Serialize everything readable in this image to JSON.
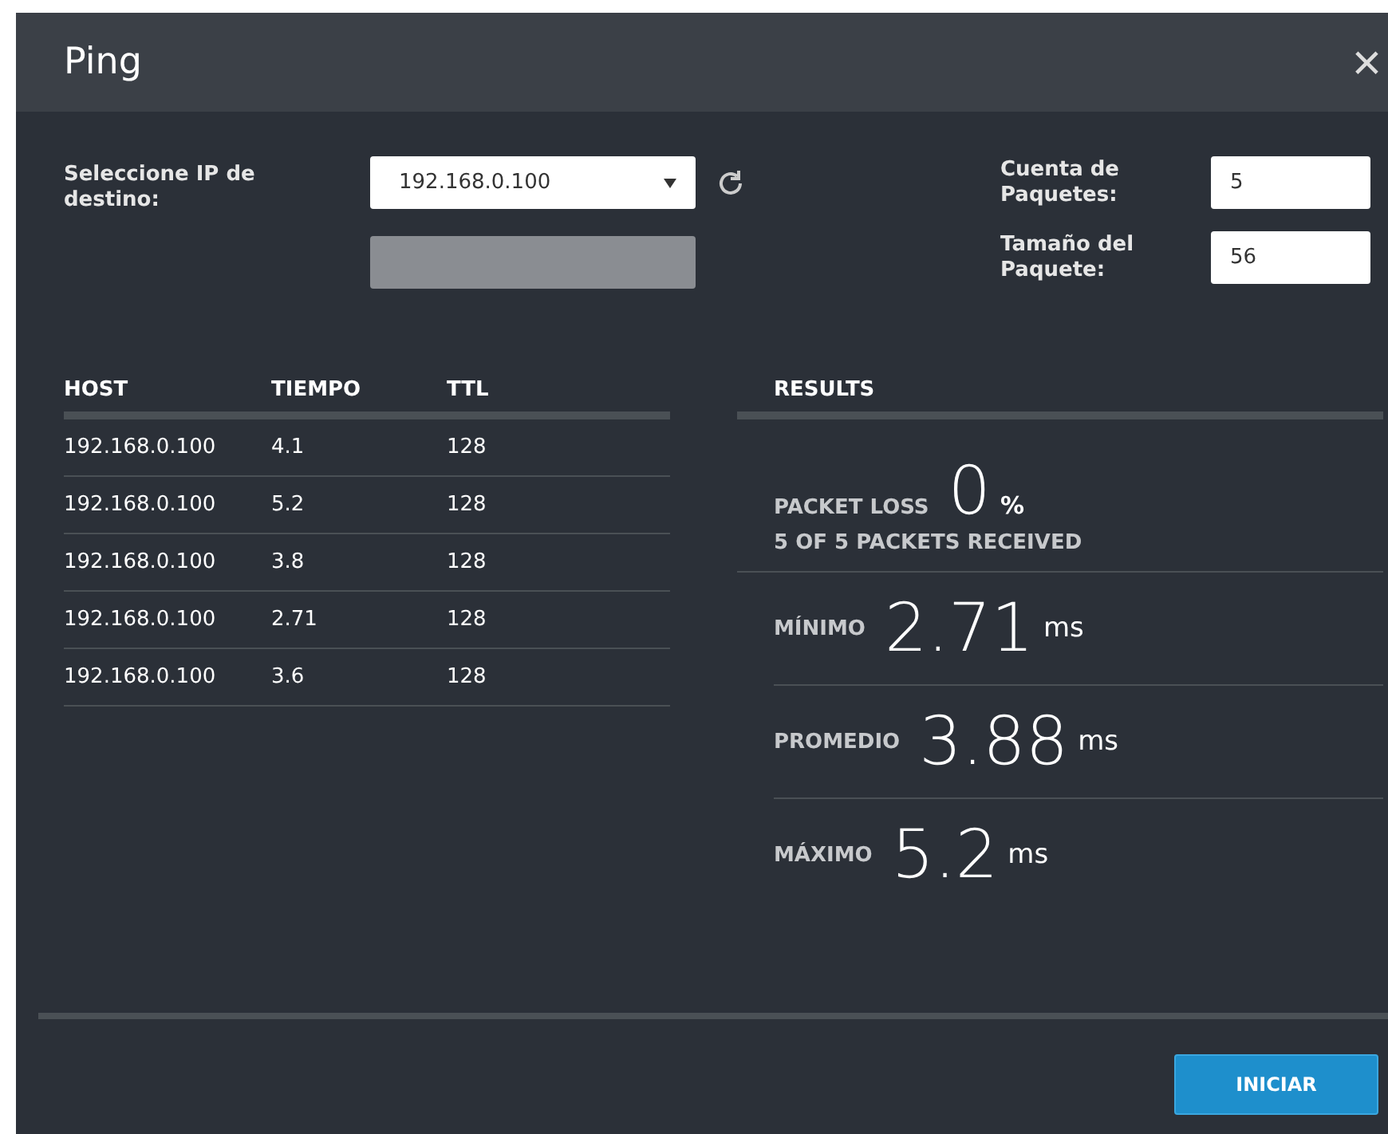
{
  "window": {
    "title": "Ping",
    "close": "×"
  },
  "form": {
    "target_label": "Seleccione IP de destino:",
    "target_value": "192.168.0.100",
    "count_label": "Cuenta de Paquetes:",
    "count_value": "5",
    "size_label": "Tamaño del Paquete:",
    "size_value": "56"
  },
  "table": {
    "columns": [
      "HOST",
      "TIEMPO",
      "TTL"
    ],
    "rows": [
      {
        "host": "192.168.0.100",
        "time": "4.1",
        "ttl": "128"
      },
      {
        "host": "192.168.0.100",
        "time": "5.2",
        "ttl": "128"
      },
      {
        "host": "192.168.0.100",
        "time": "3.8",
        "ttl": "128"
      },
      {
        "host": "192.168.0.100",
        "time": "2.71",
        "ttl": "128"
      },
      {
        "host": "192.168.0.100",
        "time": "3.6",
        "ttl": "128"
      }
    ]
  },
  "results": {
    "title": "RESULTS",
    "loss_label": "PACKET LOSS",
    "loss_value": "0",
    "loss_unit": "%",
    "received": "5 OF 5 PACKETS RECEIVED",
    "stats": [
      {
        "label": "MÍNIMO",
        "value": "2.71",
        "unit": "ms"
      },
      {
        "label": "PROMEDIO",
        "value": "3.88",
        "unit": "ms"
      },
      {
        "label": "MÁXIMO",
        "value": "5.2",
        "unit": "ms"
      }
    ]
  },
  "buttons": [
    "INICIAR"
  ]
}
